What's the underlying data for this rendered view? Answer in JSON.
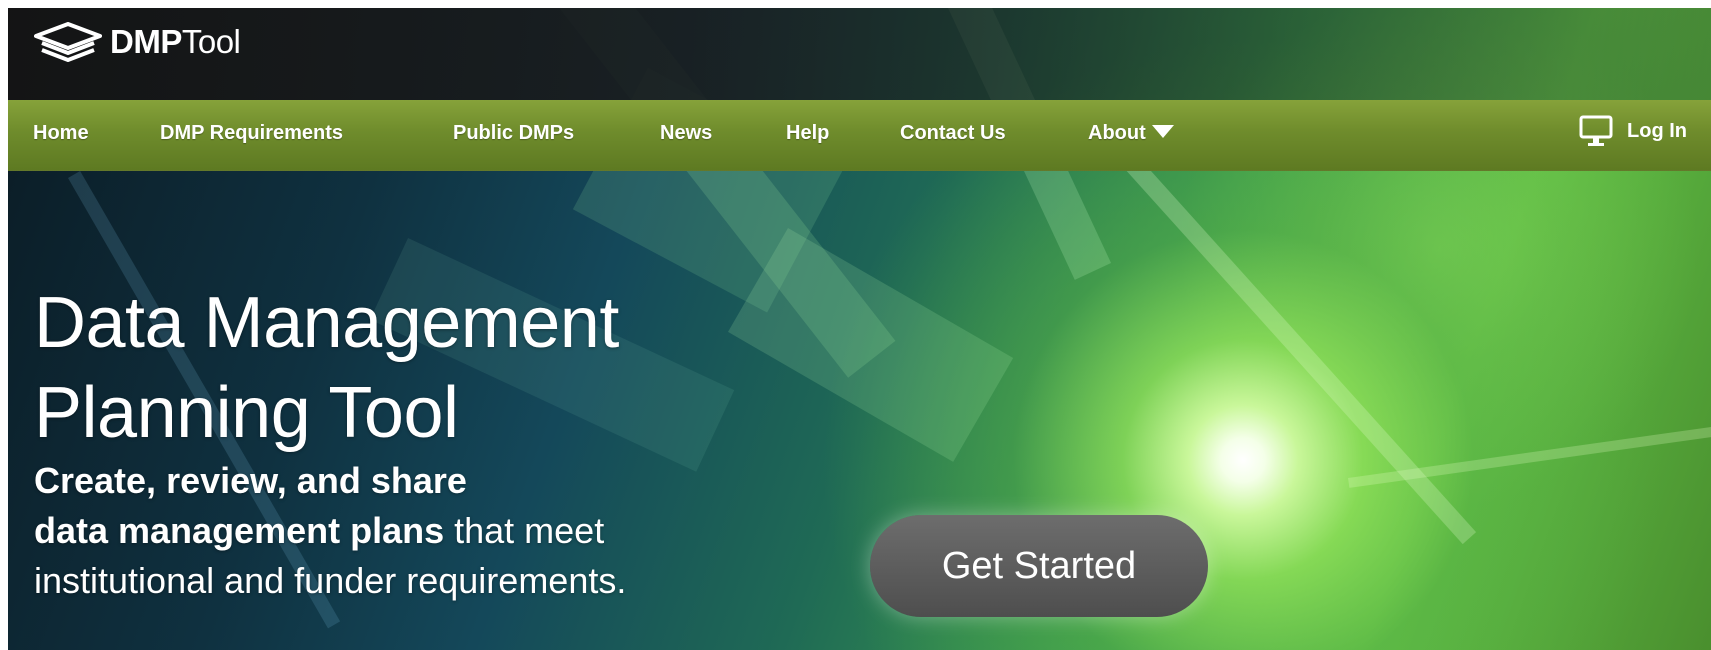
{
  "brand": {
    "logo_bold": "DMP",
    "logo_light": "Tool",
    "logo_icon": "stacked-layers-icon"
  },
  "nav": {
    "items": [
      {
        "label": "Home"
      },
      {
        "label": "DMP Requirements"
      },
      {
        "label": "Public DMPs"
      },
      {
        "label": "News"
      },
      {
        "label": "Help"
      },
      {
        "label": "Contact Us"
      },
      {
        "label": "About",
        "icon": "caret-down-icon"
      }
    ],
    "login": {
      "label": "Log In",
      "icon": "monitor-icon"
    }
  },
  "hero": {
    "title_line1": "Data Management",
    "title_line2": "Planning Tool",
    "sub_line1": "Create, review, and share",
    "sub_line2_bold": "data management plans",
    "sub_line2_rest": " that meet",
    "sub_line3": "institutional and funder requirements.",
    "cta_label": "Get Started"
  },
  "colors": {
    "nav_green": "#6f8c2c",
    "topbar": "#181818",
    "cta_gray": "#5a5a5a"
  }
}
